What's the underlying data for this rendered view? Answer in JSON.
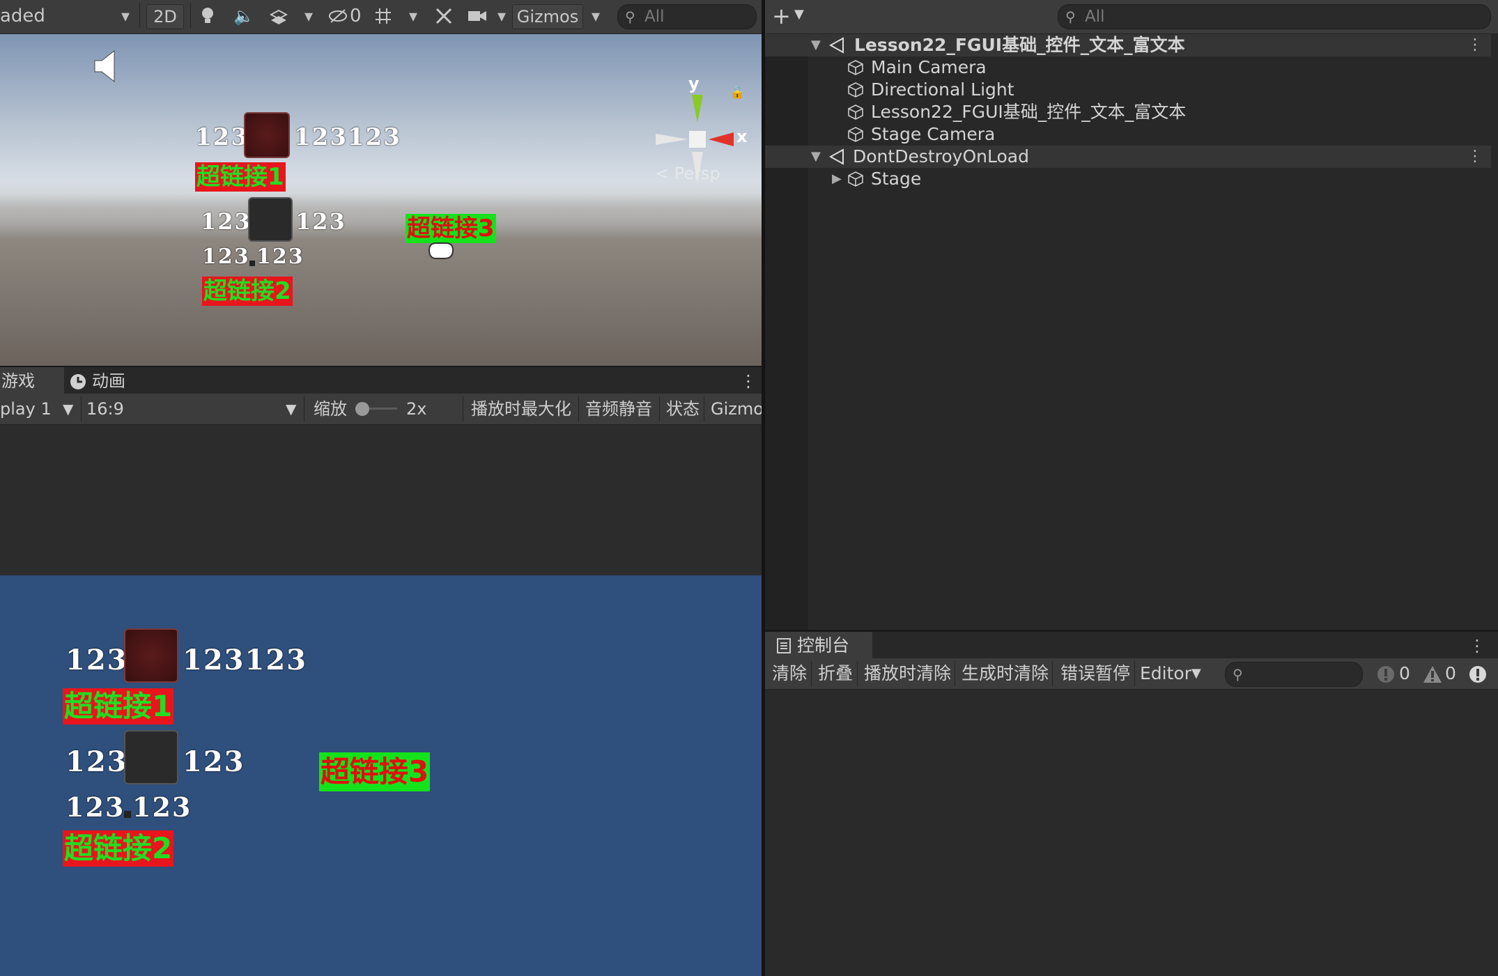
{
  "scene_toolbar": {
    "shading_mode": "aded",
    "mode_2d": "2D",
    "hidden_count": "0",
    "gizmos_label": "Gizmos",
    "search_placeholder": "All"
  },
  "scene_view": {
    "persp_label": "< Persp",
    "gizmo_y": "y",
    "gizmo_x": "x",
    "rich_text": {
      "line1_left": "123",
      "line1_right": "123123",
      "link1": "超链接1",
      "line2_left": "123",
      "line2_right": "123",
      "line3_left": "123",
      "line3_right": "123",
      "link2": "超链接2",
      "link3": "超链接3"
    }
  },
  "game_tabs": {
    "game": "游戏",
    "animation": "动画"
  },
  "game_toolbar": {
    "display": "play 1",
    "aspect": "16:9",
    "scale_label": "缩放",
    "scale_value": "2x",
    "maximize_on_play": "播放时最大化",
    "mute_audio": "音频静音",
    "stats": "状态",
    "gizmos": "Gizmo"
  },
  "hierarchy": {
    "search_placeholder": "All",
    "items": [
      {
        "label": "Lesson22_FGUI基础_控件_文本_富文本",
        "type": "scene"
      },
      {
        "label": "Main Camera",
        "type": "object"
      },
      {
        "label": "Directional Light",
        "type": "object"
      },
      {
        "label": "Lesson22_FGUI基础_控件_文本_富文本",
        "type": "object"
      },
      {
        "label": "Stage Camera",
        "type": "object"
      },
      {
        "label": "DontDestroyOnLoad",
        "type": "scene"
      },
      {
        "label": "Stage",
        "type": "object"
      }
    ]
  },
  "console": {
    "tab": "控制台",
    "clear": "清除",
    "collapse": "折叠",
    "clear_on_play": "播放时清除",
    "clear_on_build": "生成时清除",
    "error_pause": "错误暂停",
    "editor": "Editor",
    "error_count": "0",
    "warning_count": "0"
  }
}
